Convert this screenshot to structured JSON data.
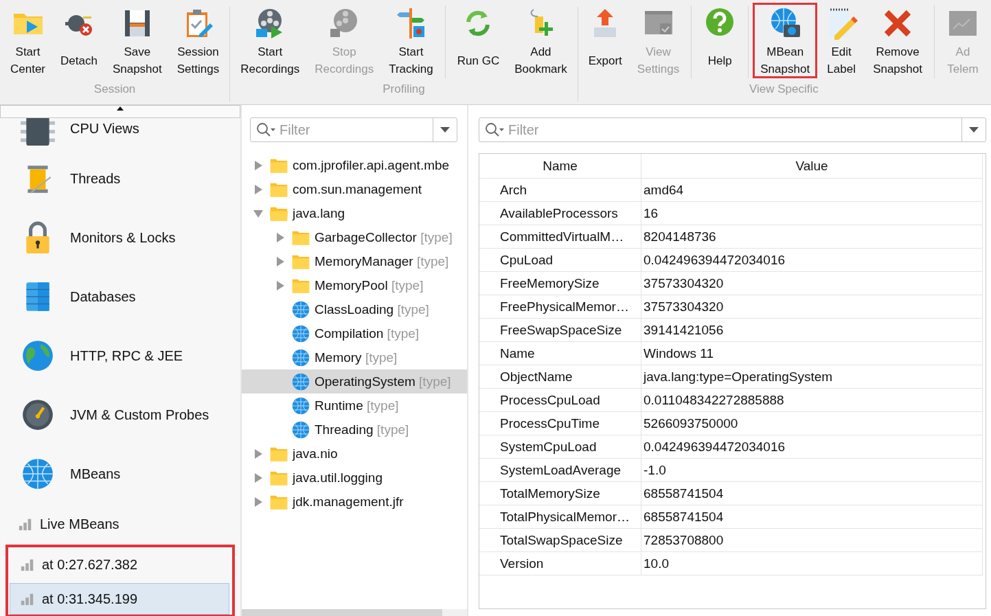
{
  "toolbar": {
    "groups": [
      {
        "label": "Session",
        "buttons": [
          {
            "lines": [
              "Start",
              "Center"
            ],
            "disabled": false,
            "separated": false,
            "highlighted": false
          },
          {
            "lines": [
              "Detach"
            ],
            "disabled": false,
            "separated": false,
            "highlighted": false
          },
          {
            "lines": [
              "Save",
              "Snapshot"
            ],
            "disabled": false,
            "separated": false,
            "highlighted": false
          },
          {
            "lines": [
              "Session",
              "Settings"
            ],
            "disabled": false,
            "separated": false,
            "highlighted": false
          }
        ]
      },
      {
        "label": "Profiling",
        "buttons": [
          {
            "lines": [
              "Start",
              "Recordings"
            ],
            "disabled": false,
            "separated": false,
            "highlighted": false
          },
          {
            "lines": [
              "Stop",
              "Recordings"
            ],
            "disabled": true,
            "separated": false,
            "highlighted": false
          },
          {
            "lines": [
              "Start",
              "Tracking"
            ],
            "disabled": false,
            "separated": false,
            "highlighted": false
          },
          {
            "lines": [
              "Run GC"
            ],
            "disabled": false,
            "separated": true,
            "highlighted": false
          },
          {
            "lines": [
              "Add",
              "Bookmark"
            ],
            "disabled": false,
            "separated": false,
            "highlighted": false
          }
        ]
      },
      {
        "label": "View Specific",
        "buttons": [
          {
            "lines": [
              "Export"
            ],
            "disabled": false,
            "separated": false,
            "highlighted": false
          },
          {
            "lines": [
              "View",
              "Settings"
            ],
            "disabled": true,
            "separated": false,
            "highlighted": false
          },
          {
            "lines": [
              "Help"
            ],
            "disabled": false,
            "separated": true,
            "highlighted": false
          },
          {
            "lines": [
              "MBean",
              "Snapshot"
            ],
            "disabled": false,
            "separated": true,
            "highlighted": true
          },
          {
            "lines": [
              "Edit",
              "Label"
            ],
            "disabled": false,
            "separated": false,
            "highlighted": false
          },
          {
            "lines": [
              "Remove",
              "Snapshot"
            ],
            "disabled": false,
            "separated": false,
            "highlighted": false
          },
          {
            "lines": [
              "Ad",
              "Telem"
            ],
            "disabled": true,
            "separated": true,
            "highlighted": false
          }
        ]
      }
    ]
  },
  "sidebar": {
    "sections": [
      {
        "label": "CPU Views"
      },
      {
        "label": "Threads"
      },
      {
        "label": "Monitors & Locks"
      },
      {
        "label": "Databases"
      },
      {
        "label": "HTTP, RPC & JEE"
      },
      {
        "label": "JVM & Custom Probes"
      },
      {
        "label": "MBeans"
      }
    ],
    "live": {
      "label": "Live MBeans"
    },
    "snapshots": {
      "highlighted": true,
      "items": [
        {
          "label": "at 0:27.627.382",
          "selected": false
        },
        {
          "label": "at 0:31.345.199",
          "selected": true
        }
      ]
    }
  },
  "tree": {
    "filter": {
      "placeholder": "Filter"
    },
    "items": [
      {
        "kind": "folder",
        "name": "com.jprofiler.api.agent.mbe",
        "expanded": false,
        "selected": false
      },
      {
        "kind": "folder",
        "name": "com.sun.management",
        "expanded": false,
        "selected": false
      },
      {
        "kind": "folder",
        "name": "java.lang",
        "expanded": true,
        "selected": false,
        "children": [
          {
            "kind": "folder",
            "name": "GarbageCollector",
            "suffix": "[type]",
            "expanded": false,
            "selected": false
          },
          {
            "kind": "folder",
            "name": "MemoryManager",
            "suffix": "[type]",
            "expanded": false,
            "selected": false
          },
          {
            "kind": "folder",
            "name": "MemoryPool",
            "suffix": "[type]",
            "expanded": false,
            "selected": false
          },
          {
            "kind": "bean",
            "name": "ClassLoading",
            "suffix": "[type]",
            "selected": false
          },
          {
            "kind": "bean",
            "name": "Compilation",
            "suffix": "[type]",
            "selected": false
          },
          {
            "kind": "bean",
            "name": "Memory",
            "suffix": "[type]",
            "selected": false
          },
          {
            "kind": "bean",
            "name": "OperatingSystem",
            "suffix": "[type]",
            "selected": true
          },
          {
            "kind": "bean",
            "name": "Runtime",
            "suffix": "[type]",
            "selected": false
          },
          {
            "kind": "bean",
            "name": "Threading",
            "suffix": "[type]",
            "selected": false
          }
        ]
      },
      {
        "kind": "folder",
        "name": "java.nio",
        "expanded": false,
        "selected": false
      },
      {
        "kind": "folder",
        "name": "java.util.logging",
        "expanded": false,
        "selected": false
      },
      {
        "kind": "folder",
        "name": "jdk.management.jfr",
        "expanded": false,
        "selected": false
      }
    ]
  },
  "attributes": {
    "filter": {
      "placeholder": "Filter"
    },
    "columns": [
      "Name",
      "Value"
    ],
    "rows": [
      [
        "Arch",
        "amd64"
      ],
      [
        "AvailableProcessors",
        "16"
      ],
      [
        "CommittedVirtualM…",
        "8204148736"
      ],
      [
        "CpuLoad",
        "0.042496394472034016"
      ],
      [
        "FreeMemorySize",
        "37573304320"
      ],
      [
        "FreePhysicalMemor…",
        "37573304320"
      ],
      [
        "FreeSwapSpaceSize",
        "39141421056"
      ],
      [
        "Name",
        "Windows 11"
      ],
      [
        "ObjectName",
        "java.lang:type=OperatingSystem"
      ],
      [
        "ProcessCpuLoad",
        "0.011048342272885888"
      ],
      [
        "ProcessCpuTime",
        "5266093750000"
      ],
      [
        "SystemCpuLoad",
        "0.042496394472034016"
      ],
      [
        "SystemLoadAverage",
        "-1.0"
      ],
      [
        "TotalMemorySize",
        "68558741504"
      ],
      [
        "TotalPhysicalMemor…",
        "68558741504"
      ],
      [
        "TotalSwapSpaceSize",
        "72853708800"
      ],
      [
        "Version",
        "10.0"
      ]
    ]
  }
}
